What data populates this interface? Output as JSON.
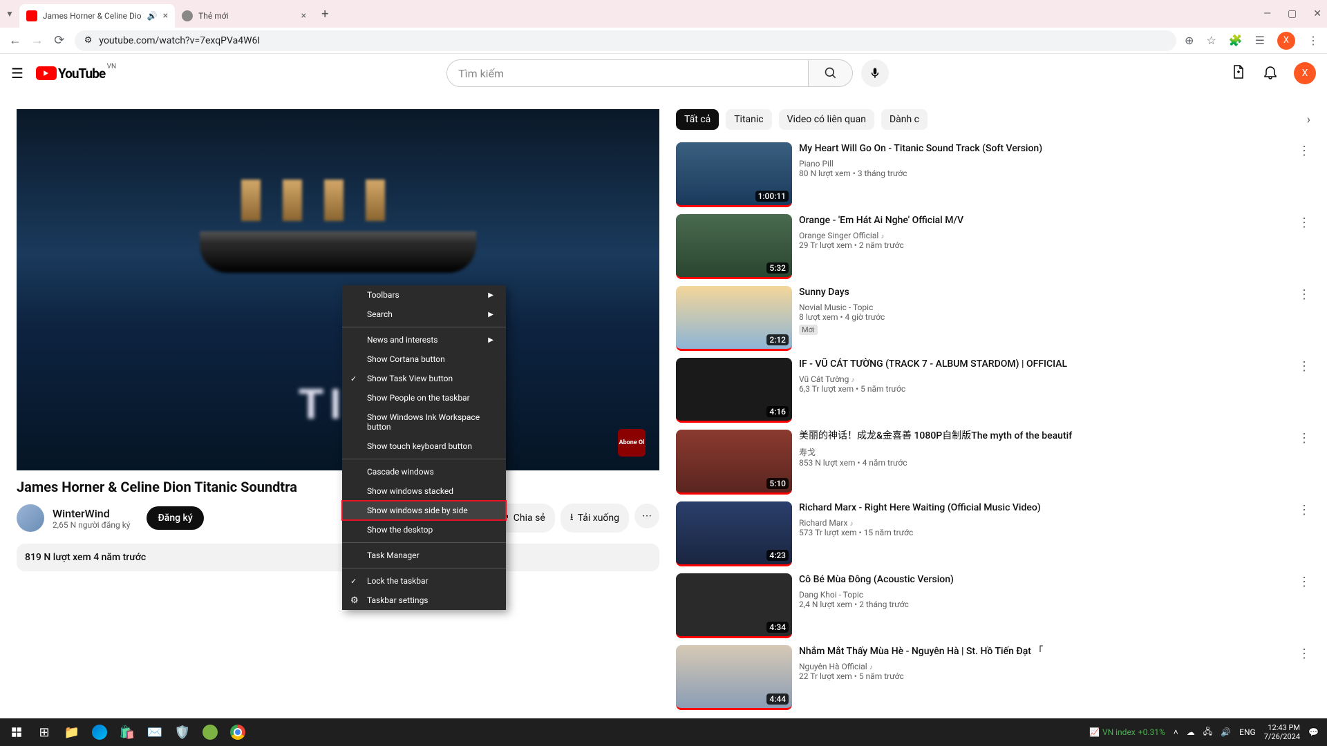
{
  "browser": {
    "tabs": [
      {
        "title": "James Horner & Celine Dio",
        "audio": true
      },
      {
        "title": "Thẻ mới"
      }
    ],
    "url": "youtube.com/watch?v=7exqPVa4W6I"
  },
  "yt": {
    "country": "VN",
    "logo_text": "YouTube",
    "search_placeholder": "Tìm kiếm",
    "avatar_letter": "X"
  },
  "video": {
    "title": "James Horner & Celine Dion Titanic Soundtra",
    "channel_name": "WinterWind",
    "channel_subs": "2,65 N người đăng ký",
    "subscribe": "Đăng ký",
    "share": "Chia sẻ",
    "download": "Tải xuống",
    "views_date": "819 N lượt xem   4 năm trước",
    "watermark": "Abone Ol",
    "overlay_text": "TIT"
  },
  "chips": [
    "Tất cả",
    "Titanic",
    "Video có liên quan",
    "Dành c"
  ],
  "recs": [
    {
      "title": "My Heart Will Go On - Titanic Sound Track (Soft Version)",
      "channel": "Piano Pill",
      "stats": "80 N lượt xem  •  3 tháng trước",
      "dur": "1:00:11",
      "bg": "linear-gradient(#3a5f7f,#1a3a5c)"
    },
    {
      "title": "Orange - 'Em Hát Ai Nghe' Official M/V",
      "channel": "Orange Singer Official",
      "stats": "29 Tr lượt xem  •  2 năm trước",
      "dur": "5:32",
      "verified": true,
      "bg": "linear-gradient(#4a6b4f,#2a4530)"
    },
    {
      "title": "Sunny Days",
      "channel": "Novial Music - Topic",
      "stats": "8 lượt xem  •  4 giờ trước",
      "dur": "2:12",
      "badge": "Mới",
      "bg": "linear-gradient(#f4d699,#8db5d6)"
    },
    {
      "title": "IF - VŨ CÁT TƯỜNG (TRACK 7 - ALBUM STARDOM) | OFFICIAL",
      "channel": "Vũ Cát Tường",
      "stats": "6,3 Tr lượt xem  •  5 năm trước",
      "dur": "4:16",
      "verified": true,
      "bg": "#1a1a1a"
    },
    {
      "title": "美丽的神话！成龙&金喜善 1080P自制版The myth of the beautif",
      "channel": "寿戈",
      "stats": "853 N lượt xem  •  4 năm trước",
      "dur": "5:10",
      "bg": "linear-gradient(#8b3a2f,#5a2520)"
    },
    {
      "title": "Richard Marx - Right Here Waiting (Official Music Video)",
      "channel": "Richard Marx",
      "stats": "573 Tr lượt xem  •  15 năm trước",
      "dur": "4:23",
      "verified": true,
      "bg": "linear-gradient(#2a3f6b,#1a2540)"
    },
    {
      "title": "Cô Bé Mùa Đông (Acoustic Version)",
      "channel": "Dang Khoi - Topic",
      "stats": "2,4 N lượt xem  •  2 tháng trước",
      "dur": "4:34",
      "bg": "#2a2a2a"
    },
    {
      "title": "Nhắm Mắt Thấy Mùa Hè - Nguyên Hà | St. Hồ Tiến Đạt 「",
      "channel": "Nguyên Hà Official",
      "stats": "22 Tr lượt xem  •  5 năm trước",
      "dur": "4:44",
      "verified": true,
      "bg": "linear-gradient(#d6c9b5,#8a9db5)"
    }
  ],
  "ctx": {
    "items": [
      {
        "label": "Toolbars",
        "arrow": true
      },
      {
        "label": "Search",
        "arrow": true
      },
      {
        "sep": true
      },
      {
        "label": "News and interests",
        "arrow": true
      },
      {
        "label": "Show Cortana button"
      },
      {
        "label": "Show Task View button",
        "check": true
      },
      {
        "label": "Show People on the taskbar"
      },
      {
        "label": "Show Windows Ink Workspace button"
      },
      {
        "label": "Show touch keyboard button"
      },
      {
        "sep": true
      },
      {
        "label": "Cascade windows"
      },
      {
        "label": "Show windows stacked"
      },
      {
        "label": "Show windows side by side",
        "highlighted": true
      },
      {
        "label": "Show the desktop"
      },
      {
        "sep": true
      },
      {
        "label": "Task Manager"
      },
      {
        "sep": true
      },
      {
        "label": "Lock the taskbar",
        "check": true
      },
      {
        "label": "Taskbar settings",
        "icon": "⚙"
      }
    ]
  },
  "taskbar": {
    "stock_name": "VN index",
    "stock_change": "+0.31%",
    "time": "12:43 PM",
    "date": "7/26/2024"
  }
}
